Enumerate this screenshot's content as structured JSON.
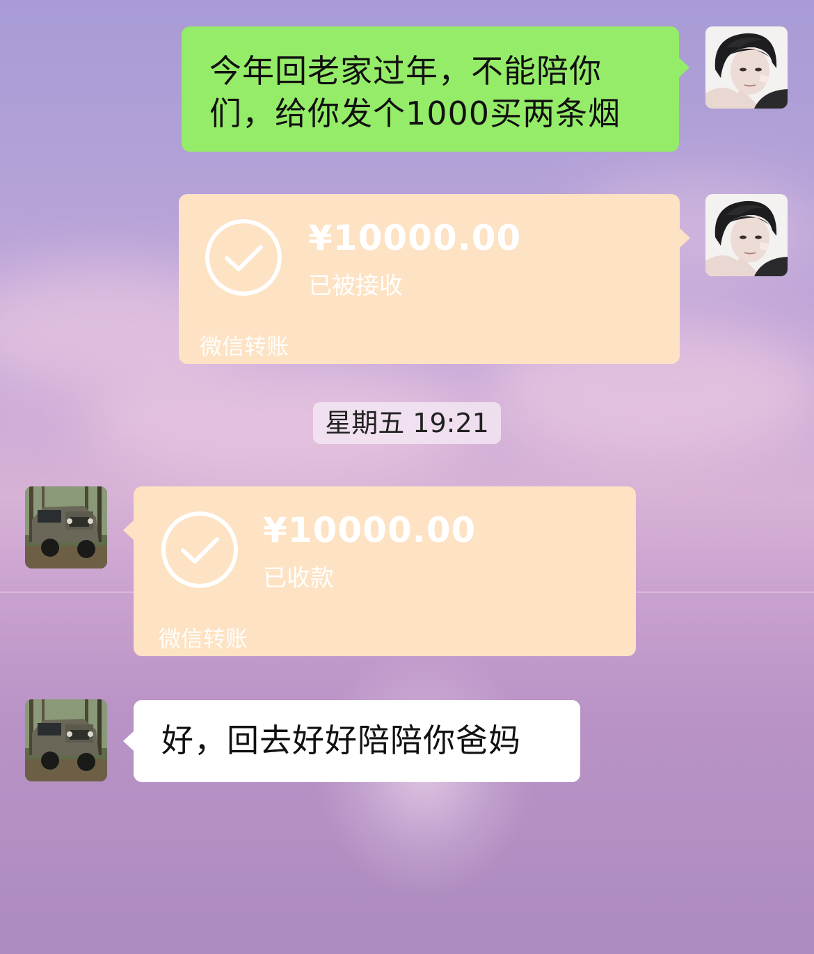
{
  "colors": {
    "my_bubble": "#95ec69",
    "their_bubble": "#ffffff",
    "transfer_bubble": "#fde2c3"
  },
  "messages": {
    "m1": {
      "sender": "me",
      "avatar": "anime-boy-avatar",
      "line1": "今年回老家过年，不能陪你",
      "line2": "们，给你发个1000买两条烟"
    },
    "transfer1": {
      "sender": "me",
      "avatar": "anime-boy-avatar",
      "amount": "¥10000.00",
      "status": "已被接收",
      "footer": "微信转账",
      "icon": "check-circle-icon"
    },
    "timestamp": "星期五 19:21",
    "transfer2": {
      "sender": "them",
      "avatar": "jeep-avatar",
      "amount": "¥10000.00",
      "status": "已收款",
      "footer": "微信转账",
      "icon": "check-circle-icon"
    },
    "m2": {
      "sender": "them",
      "avatar": "jeep-avatar",
      "text": "好，回去好好陪陪你爸妈"
    }
  }
}
